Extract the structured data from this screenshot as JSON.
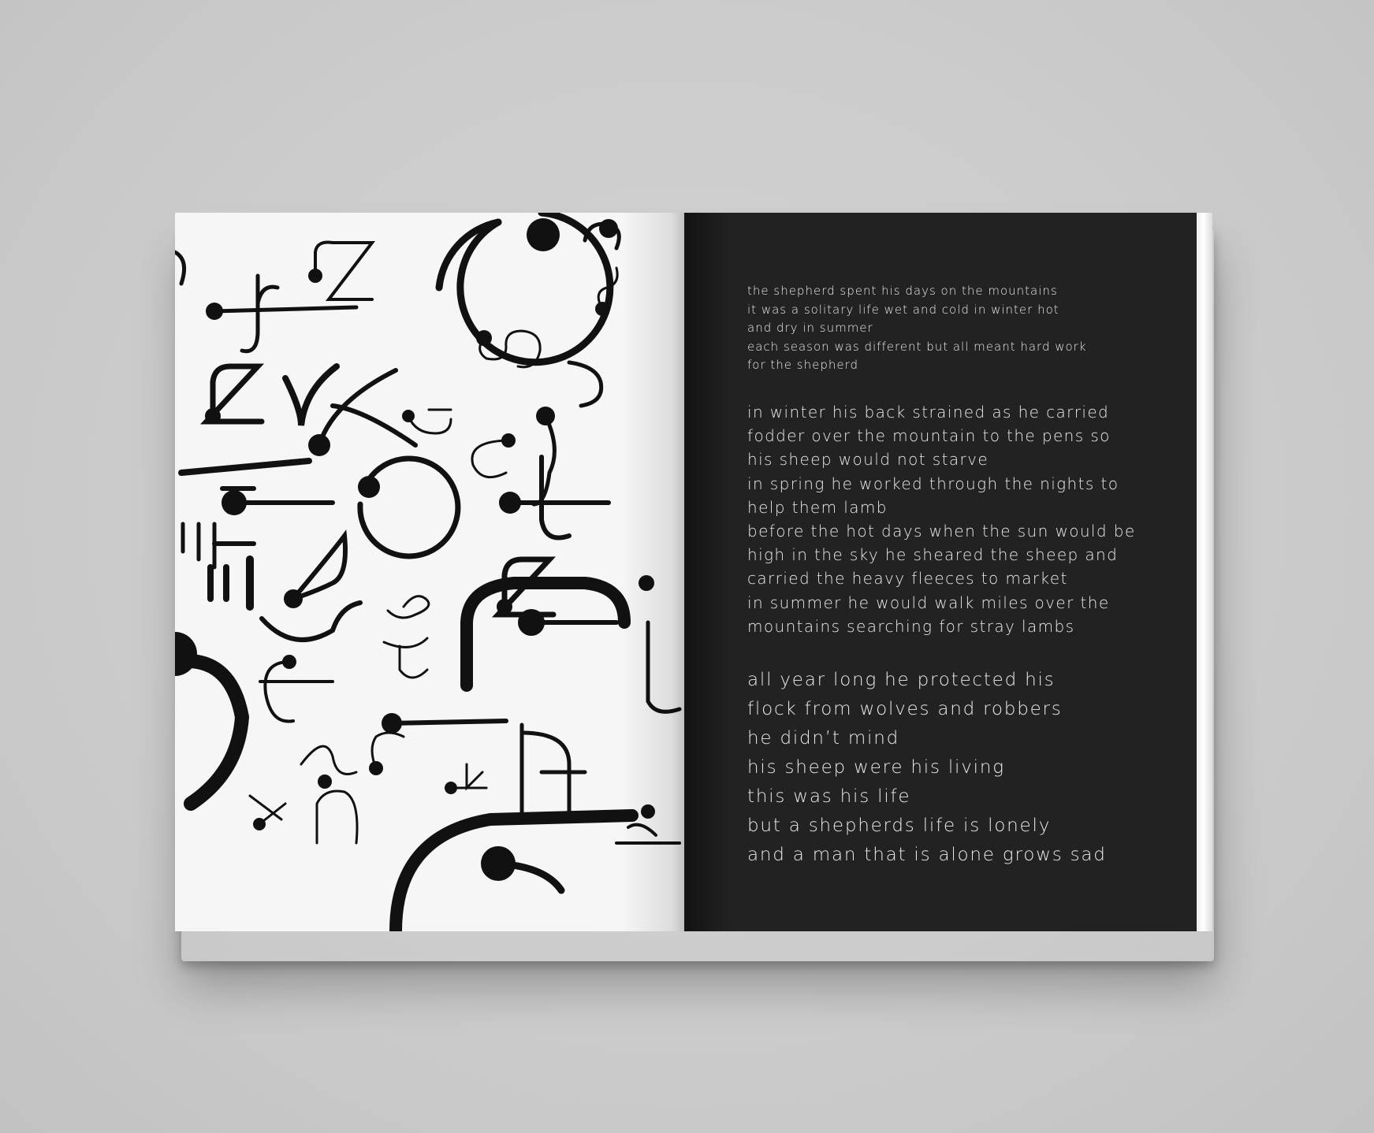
{
  "colors": {
    "background": "#cdcdcd",
    "left_page": "#f6f6f6",
    "right_page": "#222222",
    "ink": "#111111",
    "text_on_dark": "#e9e9e9"
  },
  "right_page": {
    "paragraph_1": [
      "the shepherd spent his days on the mountains",
      "it was a solitary life wet and cold in winter hot",
      "and dry in summer",
      "each season was different but all meant hard work",
      "for the shepherd"
    ],
    "paragraph_2": [
      "in winter his back strained as he carried",
      "fodder over the mountain to the pens so",
      "his sheep would not starve",
      "in spring he worked through the nights to",
      "help them lamb",
      "before the hot days when the sun would be",
      "high in the sky he sheared the sheep and",
      "carried the heavy fleeces to market",
      "in summer he would walk miles over the",
      "mountains searching for stray lambs"
    ],
    "paragraph_3": [
      "all year long he protected his",
      "flock from wolves and robbers",
      "he didn’t mind",
      "his sheep were his living",
      "this was his life",
      "but a shepherds life is lonely",
      "and a man that is alone grows sad"
    ]
  },
  "left_page": {
    "letterform_glyphs": [
      "z",
      "t",
      "s",
      "z",
      "x",
      "j",
      "c",
      "i",
      "t",
      "m",
      "w",
      "c",
      "z",
      "m",
      "e",
      "w",
      "i",
      "u",
      "m",
      "k",
      "n",
      "x",
      "e",
      "u",
      "j"
    ]
  }
}
